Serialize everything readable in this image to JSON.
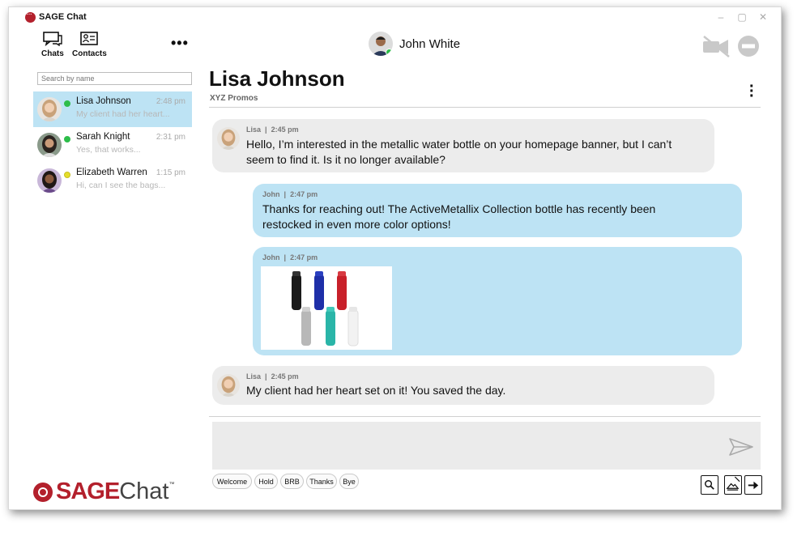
{
  "app": {
    "title": "SAGE Chat",
    "brand_sage": "SAGE",
    "brand_chat": "Chat",
    "brand_tm": "™"
  },
  "window_controls": [
    "–",
    "▢",
    "✕"
  ],
  "nav": {
    "chats_label": "Chats",
    "contacts_label": "Contacts",
    "more": "•••"
  },
  "search": {
    "placeholder": "Search by name"
  },
  "contacts": [
    {
      "name": "Lisa Johnson",
      "time": "2:48 pm",
      "preview": "My client had her heart...",
      "status_color": "#2dbd4a"
    },
    {
      "name": "Sarah Knight",
      "time": "2:31 pm",
      "preview": "Yes, that works...",
      "status_color": "#2dbd4a"
    },
    {
      "name": "Elizabeth Warren",
      "time": "1:15 pm",
      "preview": "Hi, can I see the bags...",
      "status_color": "#e5de2a"
    }
  ],
  "current_user": {
    "name": "John White"
  },
  "conversation": {
    "name": "Lisa Johnson",
    "company": "XYZ Promos",
    "messages": [
      {
        "sender": "Lisa",
        "time": "2:45 pm",
        "text_line1": "Hello, I’m interested in the metallic water bottle on your homepage banner, but I can’t",
        "text_line2": "seem to find it. Is it no longer available?"
      },
      {
        "sender": "John",
        "time": "2:47 pm",
        "text_line1": "Thanks for reaching out! The ActiveMetallix Collection bottle has recently been",
        "text_line2": "restocked in even more color options!"
      },
      {
        "sender": "John",
        "time": "2:47 pm"
      },
      {
        "sender": "Lisa",
        "time": "2:45 pm",
        "text_line1": "My client had her heart set on it! You saved the day."
      }
    ],
    "separator": "|"
  },
  "quick_replies": [
    "Welcome",
    "Hold",
    "BRB",
    "Thanks",
    "Bye"
  ],
  "colors": {
    "accent_red": "#b3202c",
    "bubble_out": "#bde3f4",
    "bubble_in": "#ececec"
  },
  "icons": [
    "chats-icon",
    "contacts-icon",
    "video-off-icon",
    "dnd-icon",
    "send-icon",
    "search-doc-icon",
    "image-doc-icon",
    "export-doc-icon"
  ]
}
